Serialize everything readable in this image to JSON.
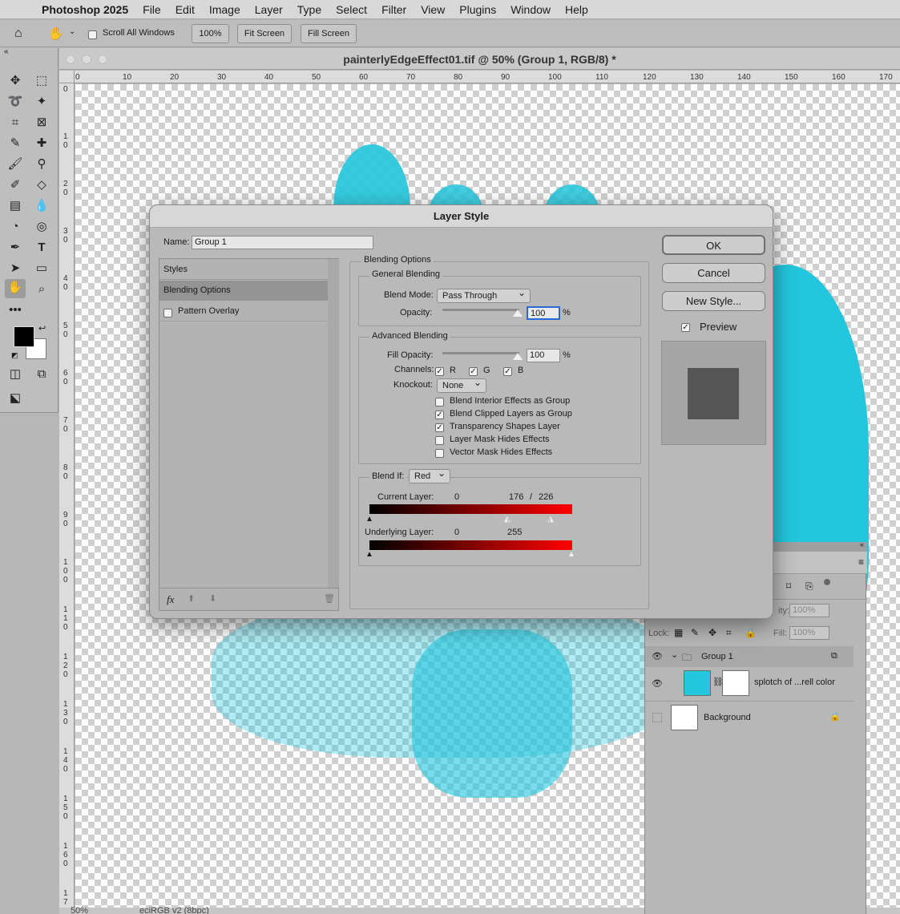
{
  "menubar": {
    "app": "Photoshop 2025",
    "items": [
      "File",
      "Edit",
      "Image",
      "Layer",
      "Type",
      "Select",
      "Filter",
      "View",
      "Plugins",
      "Window",
      "Help"
    ]
  },
  "options": {
    "scroll_all": "Scroll All Windows",
    "zoom_btn": "100%",
    "fit_screen": "Fit Screen",
    "fill_screen": "Fill Screen"
  },
  "document": {
    "title": "painterlyEdgeEffect01.tif @ 50% (Group 1, RGB/8) *",
    "zoom": "50%",
    "profile": "eciRGB v2 (8bpc)",
    "hruler": [
      "0",
      "10",
      "20",
      "30",
      "40",
      "50",
      "60",
      "70",
      "80",
      "90",
      "100",
      "110",
      "120",
      "130",
      "140",
      "150",
      "160",
      "170"
    ],
    "vruler": [
      "0",
      "1 0",
      "2 0",
      "3 0",
      "4 0",
      "5 0",
      "6 0",
      "7 0",
      "8 0",
      "9 0",
      "1 0 0",
      "1 1 0",
      "1 2 0",
      "1 3 0",
      "1 4 0",
      "1 5 0",
      "1 6 0",
      "1 7"
    ]
  },
  "layers": {
    "opacity_label": "ity:",
    "opacity": "100%",
    "lock": "Lock:",
    "fill_label": "Fill:",
    "fill": "100%",
    "rows": [
      {
        "name": "Group 1"
      },
      {
        "name": "splotch of ...rell color"
      },
      {
        "name": "Background"
      }
    ]
  },
  "dialog": {
    "title": "Layer Style",
    "name_label": "Name:",
    "name_value": "Group 1",
    "styles_header": "Styles",
    "blending_options": "Blending Options",
    "pattern_overlay": "Pattern Overlay",
    "fx": "fx",
    "section": "Blending Options",
    "general": "General Blending",
    "blend_mode_label": "Blend Mode:",
    "blend_mode": "Pass Through",
    "opacity_label": "Opacity:",
    "opacity": "100",
    "pct": "%",
    "advanced": "Advanced Blending",
    "fill_label": "Fill Opacity:",
    "fill": "100",
    "channels_label": "Channels:",
    "ch_r": "R",
    "ch_g": "G",
    "ch_b": "B",
    "knockout_label": "Knockout:",
    "knockout": "None",
    "opts": [
      "Blend Interior Effects as Group",
      "Blend Clipped Layers as Group",
      "Transparency Shapes Layer",
      "Layer Mask Hides Effects",
      "Vector Mask Hides Effects"
    ],
    "opts_checked": [
      false,
      true,
      true,
      false,
      false
    ],
    "blendif_label": "Blend If:",
    "blendif": "Red",
    "current_label": "Current Layer:",
    "current_low": "0",
    "current_high": "176",
    "slash": "/",
    "current_high2": "226",
    "underlying_label": "Underlying Layer:",
    "under_low": "0",
    "under_high": "255",
    "ok": "OK",
    "cancel": "Cancel",
    "new_style": "New Style...",
    "preview": "Preview"
  }
}
